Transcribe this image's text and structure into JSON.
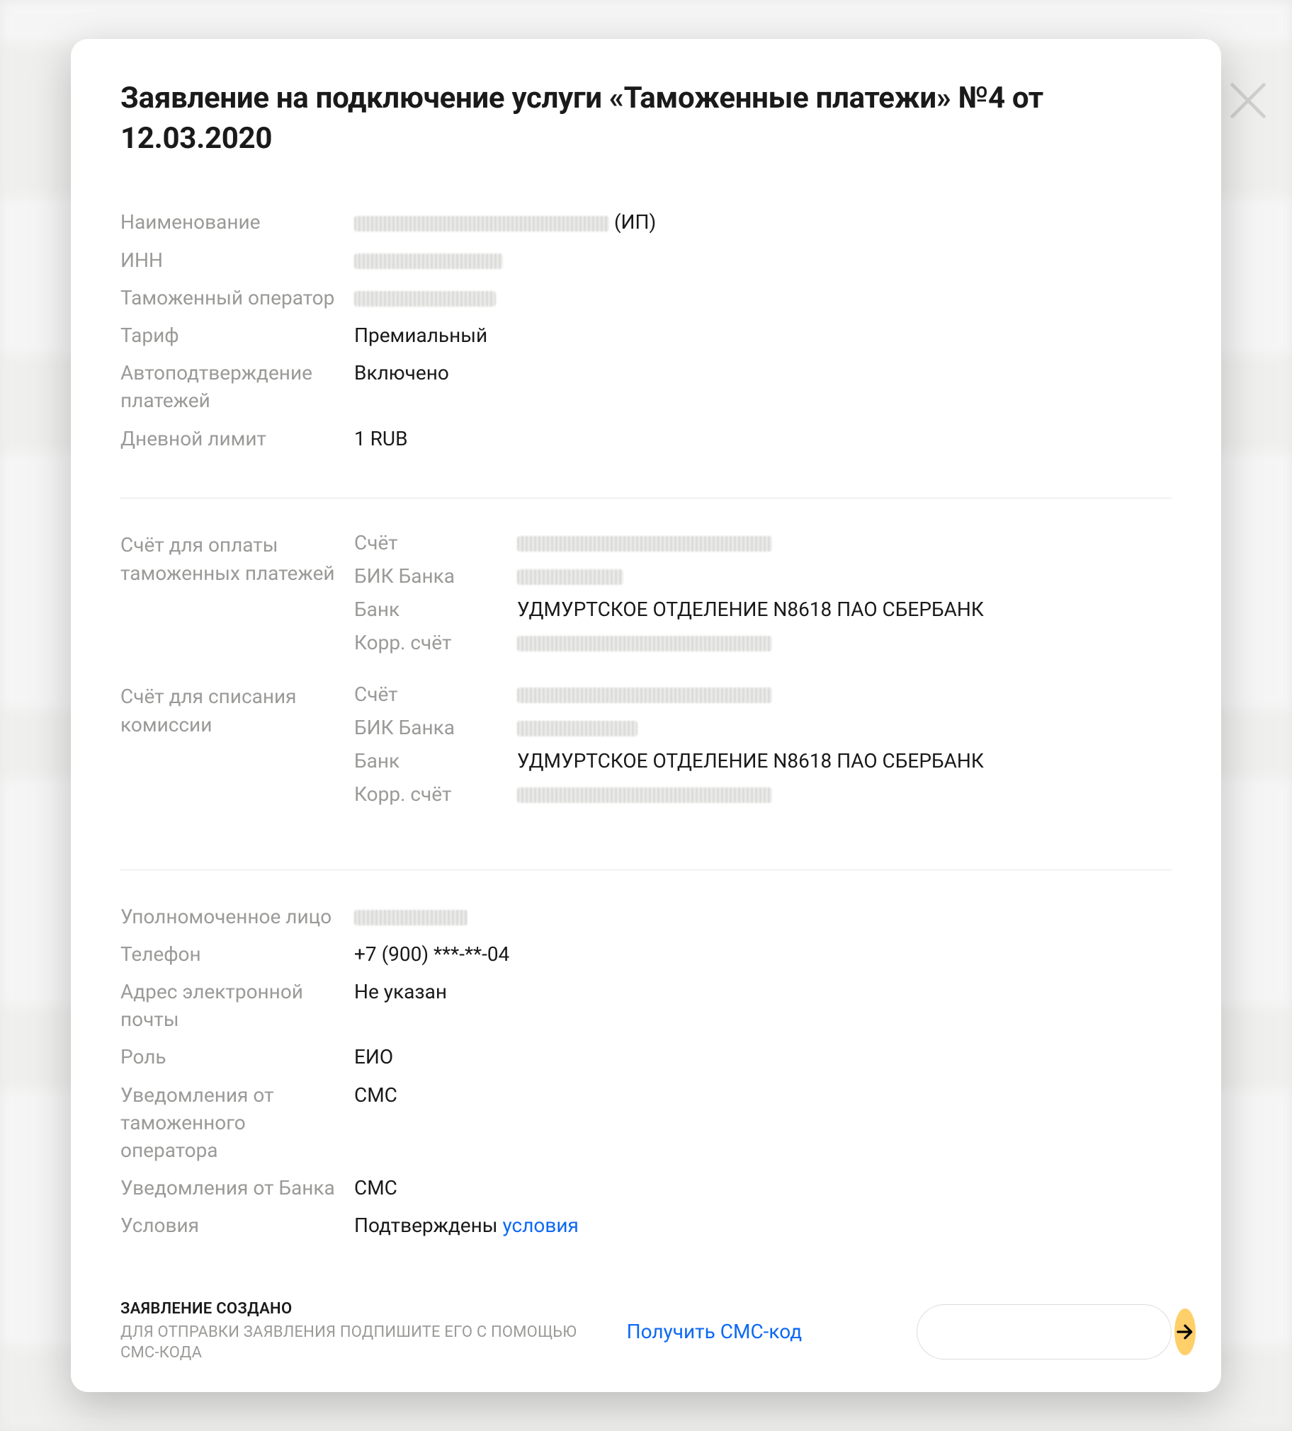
{
  "modal": {
    "title": "Заявление на подключение услуги «Таможенные платежи» №4 от 12.03.2020"
  },
  "section1": {
    "rows": [
      {
        "label": "Наименование",
        "value": "(ИП)",
        "redacted": true,
        "redactWidth": 360
      },
      {
        "label": "ИНН",
        "value": "",
        "redacted": true,
        "redactWidth": 210
      },
      {
        "label": "Таможенный оператор",
        "value": "",
        "redacted": true,
        "redactWidth": 200
      },
      {
        "label": "Тариф",
        "value": "Премиальный"
      },
      {
        "label": "Автоподтверждение платежей",
        "value": "Включено"
      },
      {
        "label": "Дневной лимит",
        "value": "1 RUB"
      }
    ]
  },
  "section2": {
    "blocks": [
      {
        "groupLabel": "Счёт для оплаты таможенных платежей",
        "rows": [
          {
            "label": "Счёт",
            "value": "",
            "redacted": true,
            "redactWidth": 360
          },
          {
            "label": "БИК Банка",
            "value": "",
            "redacted": true,
            "redactWidth": 150
          },
          {
            "label": "Банк",
            "value": "УДМУРТСКОЕ ОТДЕЛЕНИЕ N8618 ПАО СБЕРБАНК"
          },
          {
            "label": "Корр. счёт",
            "value": "",
            "redacted": true,
            "redactWidth": 360
          }
        ]
      },
      {
        "groupLabel": "Счёт для списания комиссии",
        "rows": [
          {
            "label": "Счёт",
            "value": "",
            "redacted": true,
            "redactWidth": 360
          },
          {
            "label": "БИК Банка",
            "value": "",
            "redacted": true,
            "redactWidth": 170
          },
          {
            "label": "Банк",
            "value": "УДМУРТСКОЕ ОТДЕЛЕНИЕ N8618 ПАО СБЕРБАНК"
          },
          {
            "label": "Корр. счёт",
            "value": "",
            "redacted": true,
            "redactWidth": 360
          }
        ]
      }
    ]
  },
  "section3": {
    "rows": [
      {
        "label": "Уполномоченное лицо",
        "value": "",
        "redacted": true,
        "redactWidth": 160
      },
      {
        "label": "Телефон",
        "value": "+7 (900) ***-**-04"
      },
      {
        "label": "Адрес электронной почты",
        "value": "Не указан"
      },
      {
        "label": "Роль",
        "value": "ЕИО"
      },
      {
        "label": "Уведомления от таможенного оператора",
        "value": "СМС"
      },
      {
        "label": "Уведомления от Банка",
        "value": "СМС"
      },
      {
        "label": "Условия",
        "value": "Подтверждены ",
        "link": "условия"
      }
    ]
  },
  "footer": {
    "statusTitle": "ЗАЯВЛЕНИЕ СОЗДАНО",
    "statusSub": "ДЛЯ ОТПРАВКИ ЗАЯВЛЕНИЯ ПОДПИШИТЕ ЕГО С ПОМОЩЬЮ СМС-КОДА",
    "getCodeLabel": "Получить СМС-код",
    "smsPlaceholder": ""
  }
}
